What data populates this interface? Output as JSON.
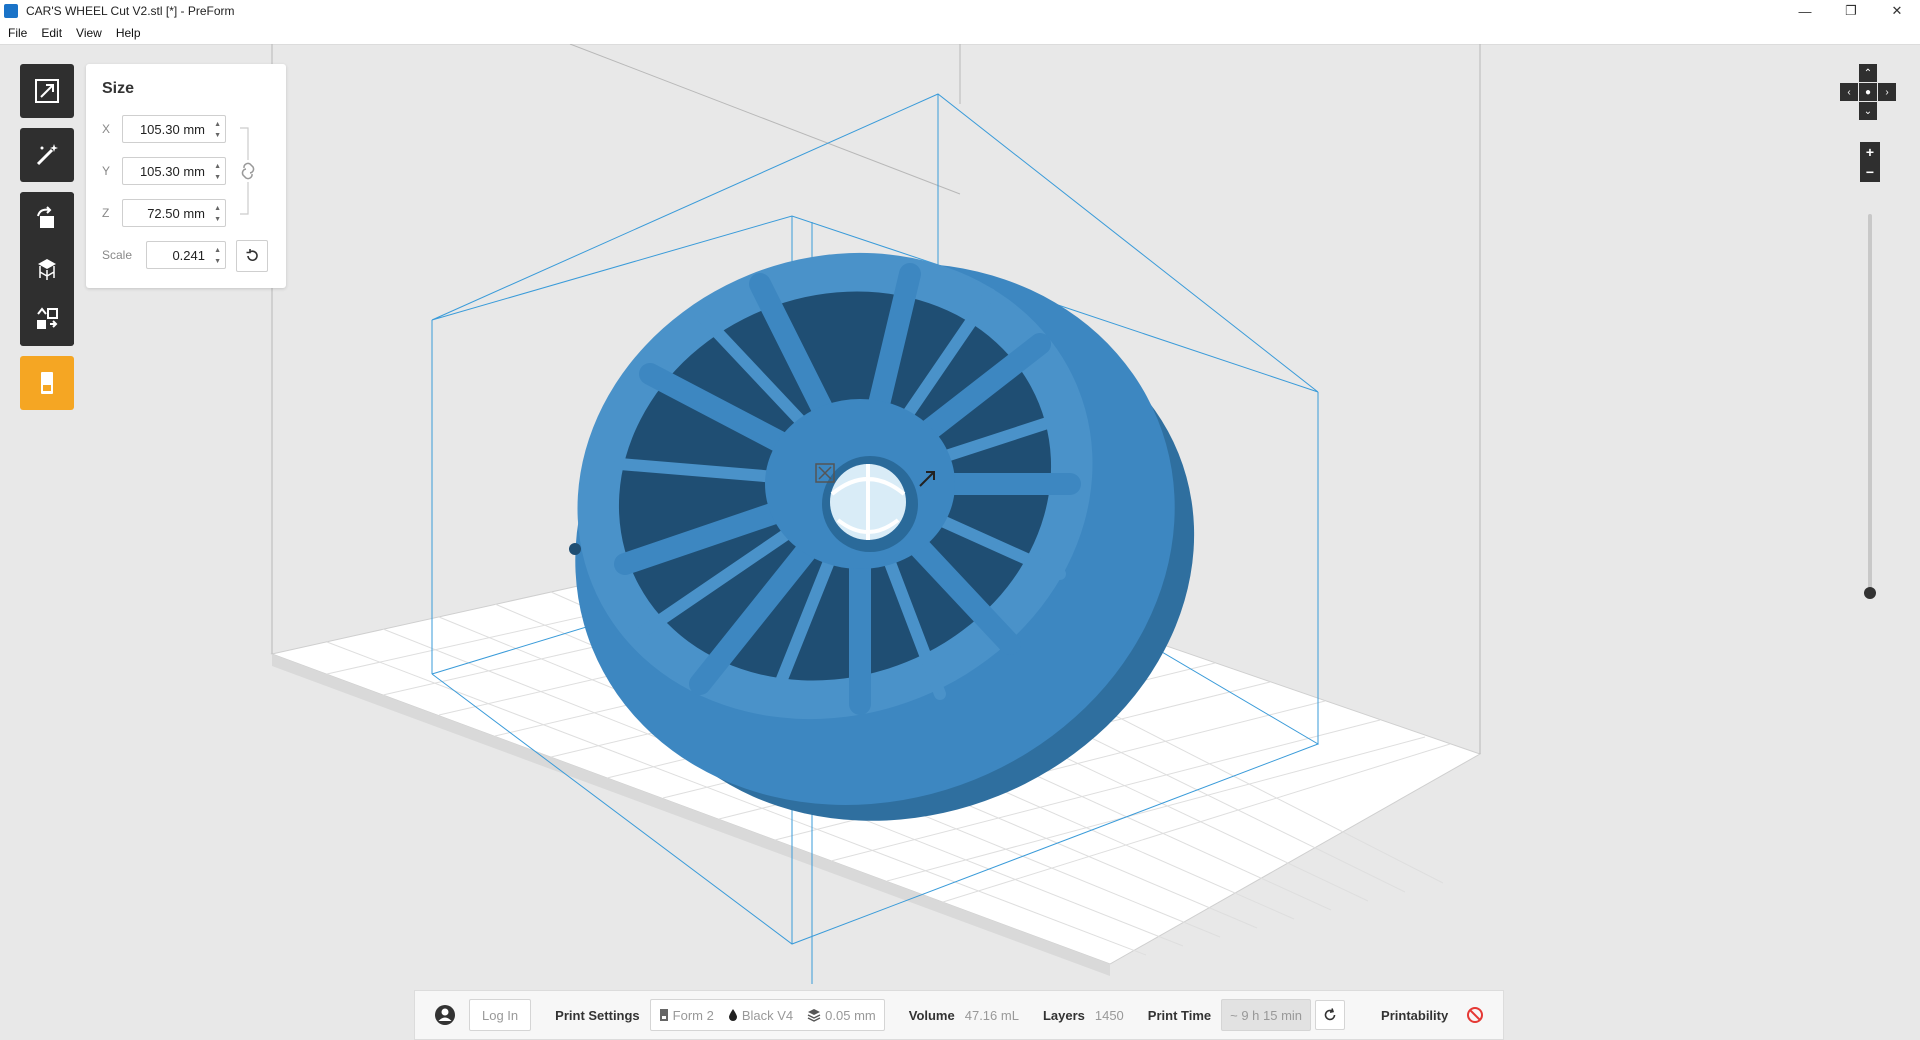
{
  "window": {
    "title": "CAR'S WHEEL Cut V2.stl [*] - PreForm",
    "controls": [
      "—",
      "❐",
      "✕"
    ]
  },
  "menu": [
    "File",
    "Edit",
    "View",
    "Help"
  ],
  "size_panel": {
    "title": "Size",
    "x_label": "X",
    "x_value": "105.30 mm",
    "y_label": "Y",
    "y_value": "105.30 mm",
    "z_label": "Z",
    "z_value": "72.50 mm",
    "scale_label": "Scale",
    "scale_value": "0.241"
  },
  "toolbar": {
    "icons": [
      "size-tool-icon",
      "magic-wand-icon",
      "orientation-icon",
      "supports-icon",
      "layout-icon",
      "print-job-icon"
    ]
  },
  "nav": {
    "up": "⌃",
    "down": "⌄",
    "left": "‹",
    "right": "›",
    "center": "●",
    "zoom_in": "+",
    "zoom_out": "−"
  },
  "bottom_bar": {
    "login": "Log In",
    "print_settings_label": "Print Settings",
    "printer": "Form 2",
    "resin": "Black V4",
    "layer_height": "0.05 mm",
    "volume_label": "Volume",
    "volume_value": "47.16 mL",
    "layers_label": "Layers",
    "layers_value": "1450",
    "print_time_label": "Print Time",
    "print_time_value": "~ 9 h 15 min",
    "printability_label": "Printability"
  },
  "colors": {
    "model": "#3d87c1",
    "accent": "#f5a623",
    "toolbar": "#2f2f2f",
    "error": "#e53935"
  }
}
